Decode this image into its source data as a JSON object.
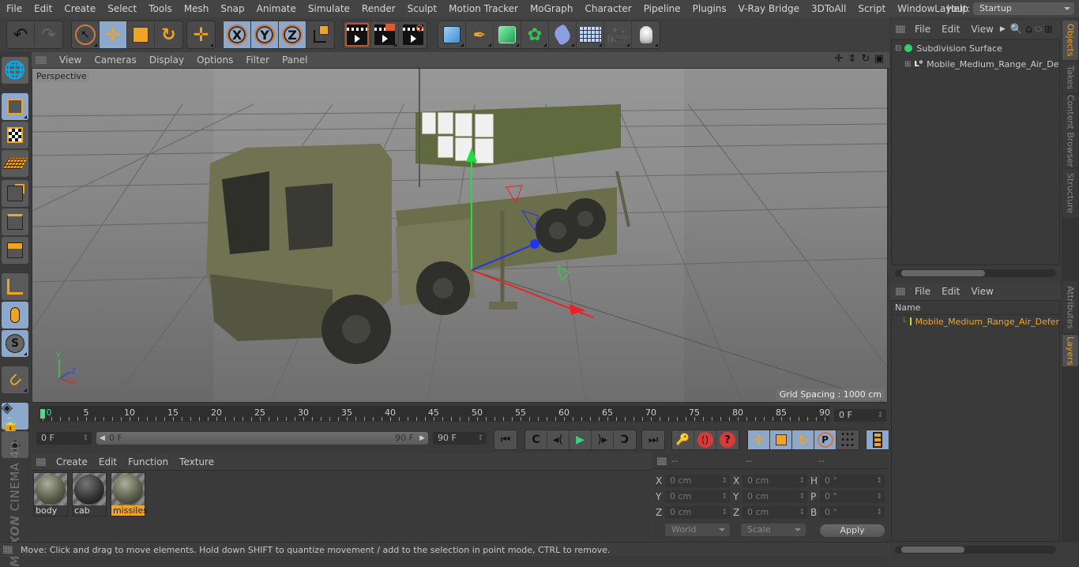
{
  "menubar": {
    "items": [
      "File",
      "Edit",
      "Create",
      "Select",
      "Tools",
      "Mesh",
      "Snap",
      "Animate",
      "Simulate",
      "Render",
      "Sculpt",
      "Motion Tracker",
      "MoGraph",
      "Character",
      "Pipeline",
      "Plugins",
      "V-Ray Bridge",
      "3DToAll",
      "Script",
      "Window",
      "Help"
    ],
    "layout_label": "Layout:",
    "layout_value": "Startup"
  },
  "toolbar": {
    "undo": "undo-icon",
    "redo": "redo-icon",
    "tools": [
      "live-selection",
      "move",
      "scale",
      "rotate",
      "recent-tool"
    ],
    "axes": [
      "X",
      "Y",
      "Z"
    ],
    "coord_system": "world-coordinate-system",
    "render": [
      "render-view",
      "render-to-picture-viewer",
      "render-settings"
    ],
    "objects": [
      "cube",
      "pen",
      "subdivision-surface",
      "cloner",
      "deformer",
      "floor",
      "camera",
      "light"
    ]
  },
  "left_palette": [
    "make-editable",
    "model-mode",
    "texture-mode",
    "workplane-mode",
    "points-mode",
    "edges-mode",
    "polygons-mode",
    "enable-axis",
    "tweak-mode",
    "solo",
    "snapping",
    "lock-workplane",
    "planar-workplane"
  ],
  "brand": {
    "maxon": "MAXON",
    "product": "CINEMA 4D"
  },
  "viewport": {
    "menu": [
      "View",
      "Cameras",
      "Display",
      "Options",
      "Filter",
      "Panel"
    ],
    "camera": "Perspective",
    "grid_spacing": "Grid Spacing : 1000 cm",
    "axis_labels": {
      "x": "X",
      "y": "Y",
      "z": "Z"
    }
  },
  "timeline": {
    "ticks": [
      0,
      5,
      10,
      15,
      20,
      25,
      30,
      35,
      40,
      45,
      50,
      55,
      60,
      65,
      70,
      75,
      80,
      85,
      90
    ],
    "current_frame_right": "0 F",
    "start_field": "0 F",
    "range_start": "0 F",
    "range_end": "90 F",
    "end_field": "90 F",
    "playhead_frame": 0,
    "max_frame": 90
  },
  "material_manager": {
    "menu": [
      "Create",
      "Edit",
      "Function",
      "Texture"
    ],
    "materials": [
      {
        "name": "body",
        "selected": false
      },
      {
        "name": "cab",
        "selected": false
      },
      {
        "name": "missiles",
        "selected": true
      }
    ]
  },
  "coordinates": {
    "headers": [
      "--",
      "--",
      "--"
    ],
    "rows": [
      {
        "l1": "X",
        "v1": "0 cm",
        "l2": "X",
        "v2": "0 cm",
        "l3": "H",
        "v3": "0 °"
      },
      {
        "l1": "Y",
        "v1": "0 cm",
        "l2": "Y",
        "v2": "0 cm",
        "l3": "P",
        "v3": "0 °"
      },
      {
        "l1": "Z",
        "v1": "0 cm",
        "l2": "Z",
        "v2": "0 cm",
        "l3": "B",
        "v3": "0 °"
      }
    ],
    "mode": "World",
    "transform": "Scale",
    "apply": "Apply"
  },
  "status": "Move: Click and drag to move elements. Hold down SHIFT to quantize movement / add to the selection in point mode, CTRL to remove.",
  "objects_panel": {
    "menu": [
      "File",
      "Edit",
      "View"
    ],
    "tree": [
      {
        "name": "Subdivision Surface",
        "expanded": true
      },
      {
        "name": "Mobile_Medium_Range_Air_Defe",
        "expanded": false
      }
    ]
  },
  "layers_panel": {
    "menu": [
      "File",
      "Edit",
      "View"
    ],
    "column": "Name",
    "layers": [
      {
        "name": "Mobile_Medium_Range_Air_Defer",
        "color": "#e0d020"
      }
    ]
  },
  "side_tabs": {
    "top": [
      "Objects",
      "Takes",
      "Content Browser",
      "Structure"
    ],
    "bottom": [
      "Attributes",
      "Layers"
    ],
    "active_top": "Objects",
    "active_bottom": "Layers"
  },
  "colors": {
    "accent": "#f0a424",
    "active_button": "#8ea8cb",
    "playhead": "#4ddb8c"
  }
}
